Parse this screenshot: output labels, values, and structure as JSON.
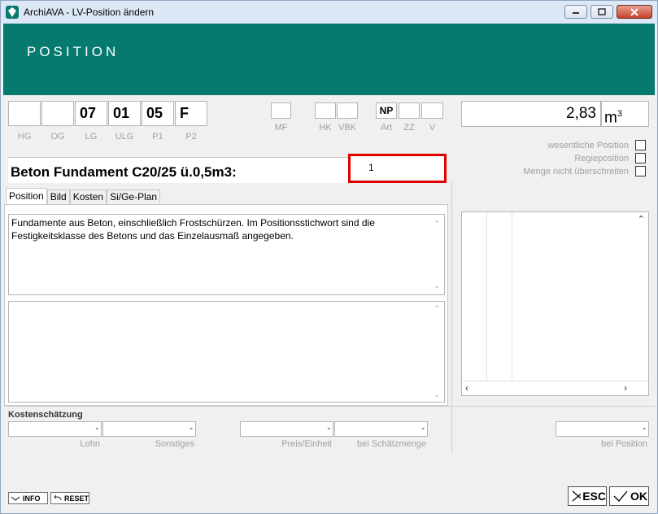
{
  "window": {
    "title": "ArchiAVA - LV-Position ändern"
  },
  "header": {
    "title": "POSITION"
  },
  "codes": {
    "hg": "",
    "og": "",
    "lg": "07",
    "ulg": "01",
    "p1": "05",
    "p2": "F",
    "labels": {
      "hg": "HG",
      "og": "OG",
      "lg": "LG",
      "ulg": "ULG",
      "p1": "P1",
      "p2": "P2"
    }
  },
  "flags": {
    "mf": "",
    "hk": "",
    "vbk": "",
    "art": "NP",
    "zz": "",
    "v": "",
    "labels": {
      "mf": "MF",
      "hk": "HK",
      "vbk": "VBK",
      "art": "Art",
      "zz": "ZZ",
      "v": "V"
    }
  },
  "quantity": {
    "value": "2,83",
    "unit": "m",
    "unit_exp": "3"
  },
  "checkboxes": [
    {
      "label": "wesentliche Position",
      "checked": false
    },
    {
      "label": "Regieposition",
      "checked": false
    },
    {
      "label": "Menge nicht überschreiten",
      "checked": false
    }
  ],
  "stichwort": "Beton Fundament C20/25 ü.0,5m3:",
  "highlight_field": {
    "value": "1"
  },
  "tabs": [
    "Position",
    "Bild",
    "Kosten",
    "Si/Ge-Plan"
  ],
  "description": "Fundamente aus Beton, einschließlich Frostschürzen. Im Positionsstichwort sind die Festigkeitsklasse des Betons und das Einzelausmaß angegeben.",
  "kosten": {
    "title": "Kostenschätzung",
    "lohn": {
      "value": "-",
      "label": "Lohn"
    },
    "sonstiges": {
      "value": "-",
      "label": "Sonstiges"
    },
    "preis": {
      "value": "-",
      "label": "Preis/Einheit"
    },
    "schaetz": {
      "value": "-",
      "label": "bei Schätzmenge"
    },
    "position": {
      "value": "-",
      "label": "bei Position"
    }
  },
  "buttons": {
    "info": "INFO",
    "reset": "RESET",
    "esc": "ESC",
    "ok": "OK"
  }
}
